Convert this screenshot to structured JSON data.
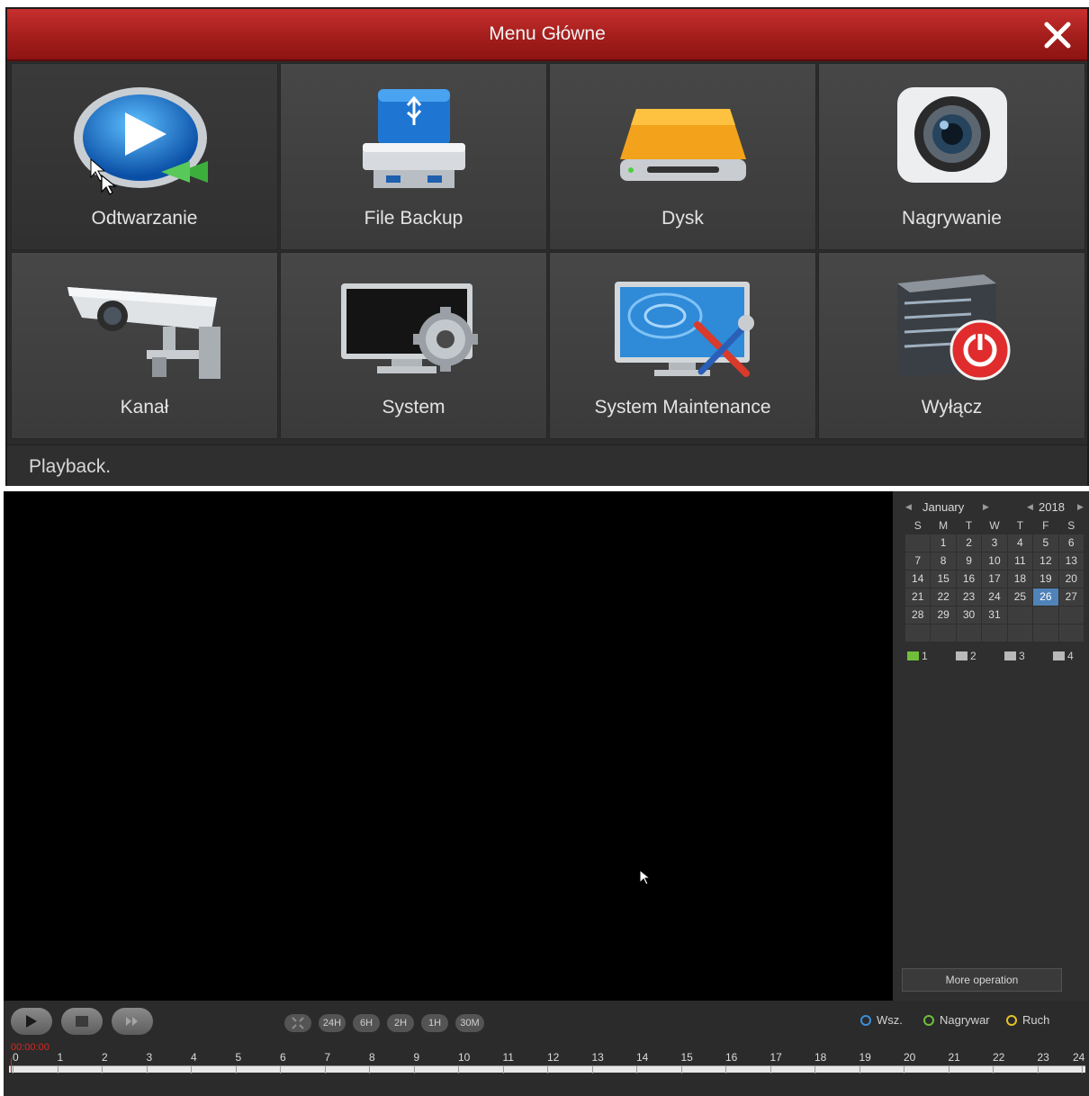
{
  "menu": {
    "title": "Menu Główne",
    "tiles": [
      {
        "label": "Odtwarzanie"
      },
      {
        "label": "File Backup"
      },
      {
        "label": "Dysk"
      },
      {
        "label": "Nagrywanie"
      },
      {
        "label": "Kanał"
      },
      {
        "label": "System"
      },
      {
        "label": "System Maintenance"
      },
      {
        "label": "Wyłącz"
      }
    ],
    "status": "Playback."
  },
  "calendar": {
    "month": "January",
    "year": "2018",
    "weekdays": [
      "S",
      "M",
      "T",
      "W",
      "T",
      "F",
      "S"
    ],
    "weeks": [
      [
        "",
        "1",
        "2",
        "3",
        "4",
        "5",
        "6"
      ],
      [
        "7",
        "8",
        "9",
        "10",
        "11",
        "12",
        "13"
      ],
      [
        "14",
        "15",
        "16",
        "17",
        "18",
        "19",
        "20"
      ],
      [
        "21",
        "22",
        "23",
        "24",
        "25",
        "26",
        "27"
      ],
      [
        "28",
        "29",
        "30",
        "31",
        "",
        "",
        ""
      ],
      [
        "",
        "",
        "",
        "",
        "",
        "",
        ""
      ]
    ],
    "selected_day": "26"
  },
  "channels": [
    {
      "label": "1",
      "checked": true
    },
    {
      "label": "2",
      "checked": false
    },
    {
      "label": "3",
      "checked": false
    },
    {
      "label": "4",
      "checked": false
    }
  ],
  "more_operation": "More operation",
  "zoom_buttons": [
    "24H",
    "6H",
    "2H",
    "1H",
    "30M"
  ],
  "legend": [
    {
      "label": "Wsz.",
      "color": "#3b8fd6"
    },
    {
      "label": "Nagrywar",
      "color": "#6fbf3a"
    },
    {
      "label": "Ruch",
      "color": "#e4c228"
    }
  ],
  "timecode": "00:00:00",
  "hours": [
    "0",
    "1",
    "2",
    "3",
    "4",
    "5",
    "6",
    "7",
    "8",
    "9",
    "10",
    "11",
    "12",
    "13",
    "14",
    "15",
    "16",
    "17",
    "18",
    "19",
    "20",
    "21",
    "22",
    "23",
    "24"
  ]
}
